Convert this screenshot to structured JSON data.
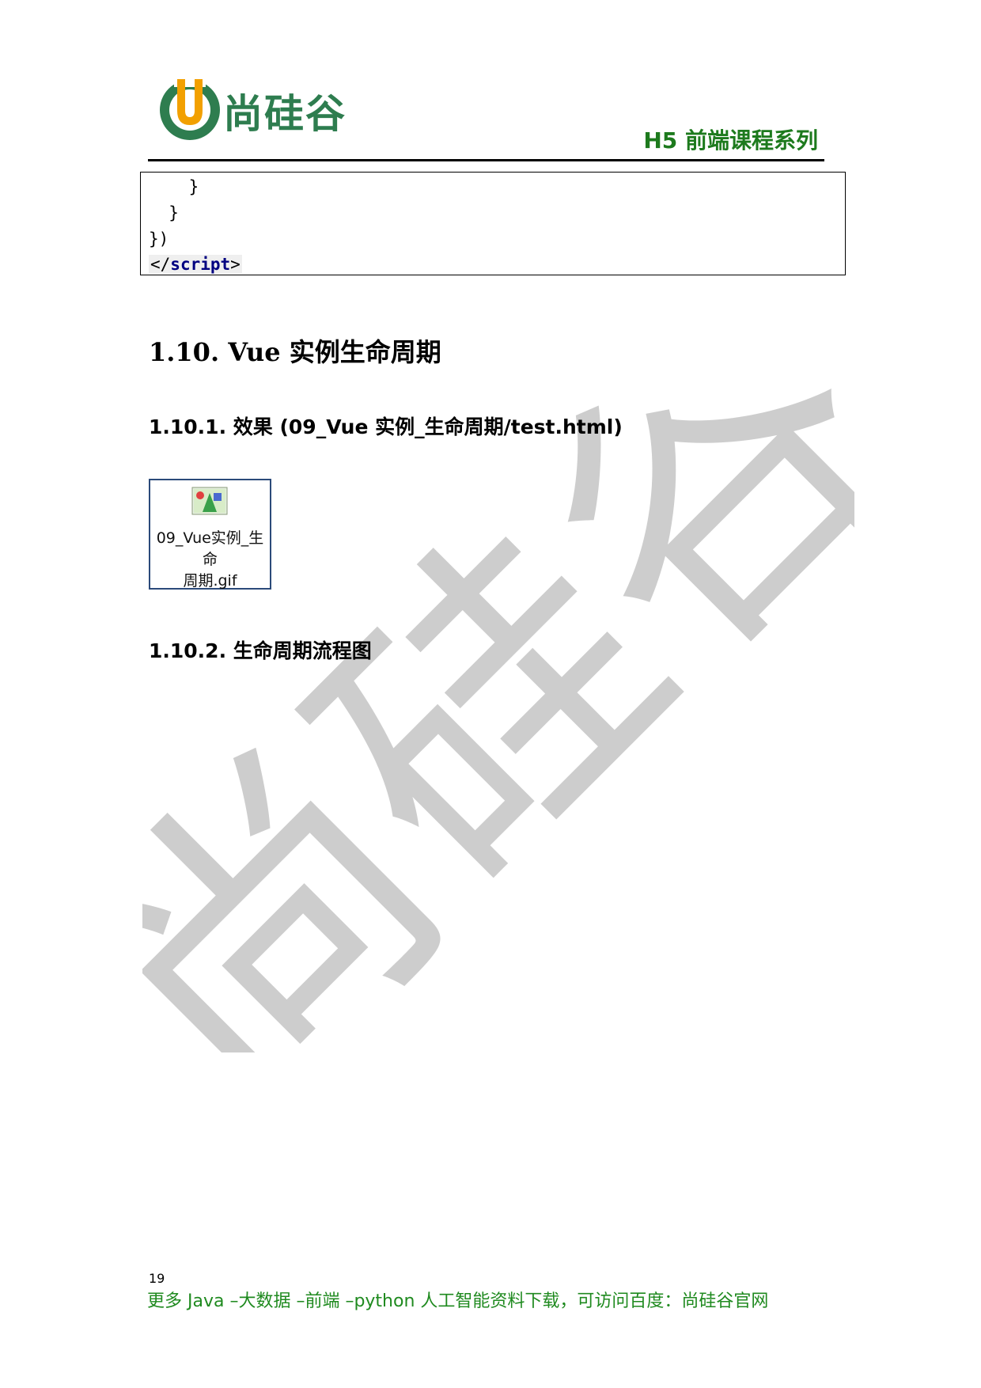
{
  "header": {
    "brand": "尚硅谷",
    "course_series": "H5 前端课程系列",
    "colors": {
      "brand_green": "#2e7d4f",
      "brand_orange": "#f2a000",
      "series_green": "#1d7a1d"
    }
  },
  "code_block": {
    "lines": [
      "    }",
      "  }",
      "})"
    ],
    "closing_tag": {
      "open": "</",
      "name": "script",
      "close": ">"
    }
  },
  "section": {
    "heading": "1.10.  Vue 实例生命周期",
    "sub1": "1.10.1.  效果  (09_Vue 实例_生命周期/test.html)",
    "attachment": {
      "name_line1": "09_Vue实例_生命",
      "name_line2": "周期.gif",
      "icon": "gif-image-icon"
    },
    "sub2": "1.10.2.  生命周期流程图"
  },
  "watermark": {
    "text": "尚硅谷"
  },
  "footer": {
    "page_number": "19",
    "text": "更多 Java –大数据 –前端 –python 人工智能资料下载，可访问百度：尚硅谷官网"
  }
}
